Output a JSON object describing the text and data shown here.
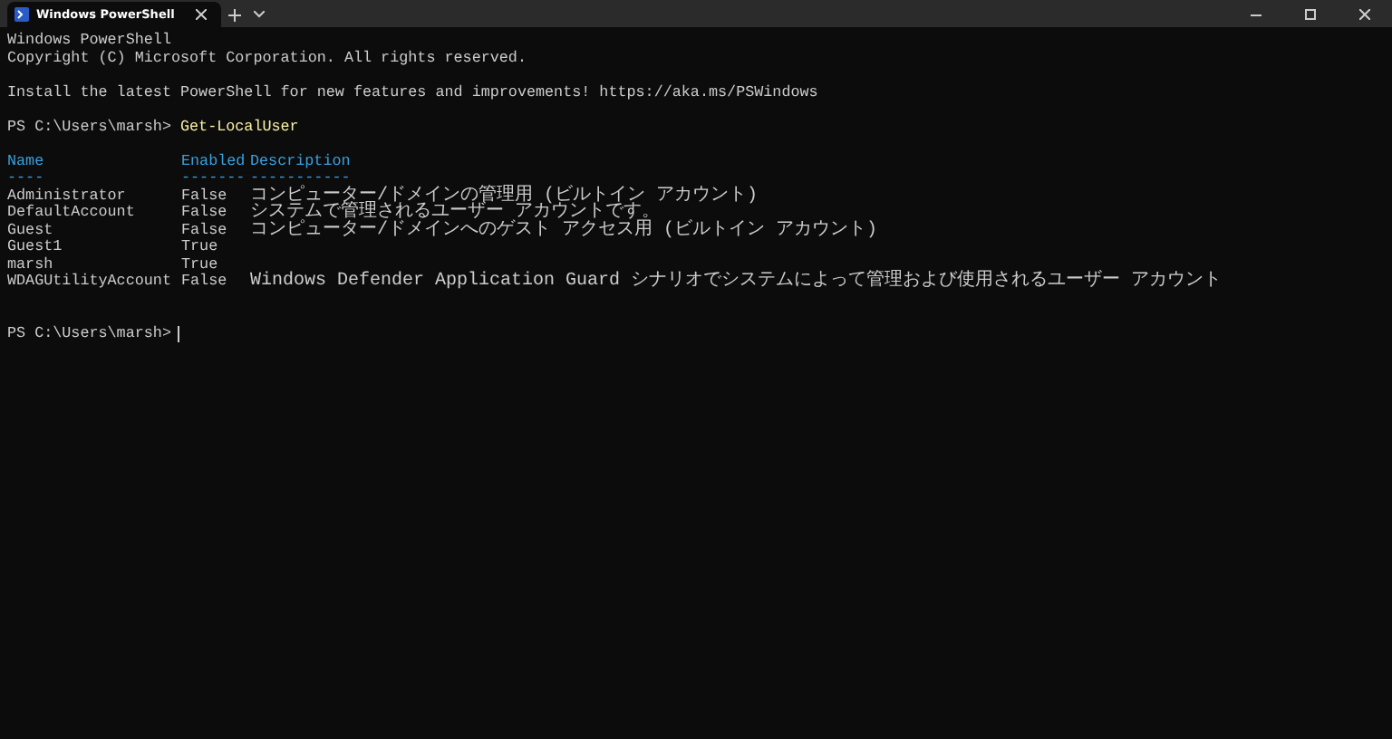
{
  "tab": {
    "title": "Windows PowerShell",
    "selected": true
  },
  "banner": [
    "Windows PowerShell",
    "Copyright (C) Microsoft Corporation. All rights reserved."
  ],
  "notice": "Install the latest PowerShell for new features and improvements! https://aka.ms/PSWindows",
  "command": {
    "prompt": "PS C:\\Users\\marsh>",
    "text": "Get-LocalUser"
  },
  "table": {
    "columns": [
      "Name",
      "Enabled",
      "Description"
    ],
    "rules": [
      "----",
      "-------",
      "-----------"
    ],
    "rows": [
      {
        "name": "Administrator",
        "enabled": "False",
        "description": "コンピューター/ドメインの管理用 (ビルトイン アカウント)"
      },
      {
        "name": "DefaultAccount",
        "enabled": "False",
        "description": "システムで管理されるユーザー アカウントです。"
      },
      {
        "name": "Guest",
        "enabled": "False",
        "description": "コンピューター/ドメインへのゲスト アクセス用 (ビルトイン アカウント)"
      },
      {
        "name": "Guest1",
        "enabled": "True"
      },
      {
        "name": "marsh",
        "enabled": "True"
      },
      {
        "name": "WDAGUtilityAccount",
        "enabled": "False",
        "description": "Windows Defender Application Guard シナリオでシステムによって管理および使用されるユーザー アカウント"
      }
    ]
  },
  "final_prompt": "PS C:\\Users\\marsh>"
}
